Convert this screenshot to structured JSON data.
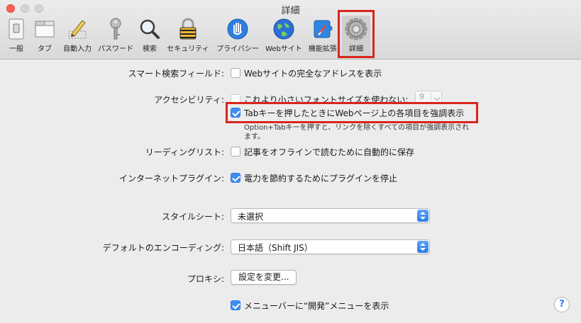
{
  "window": {
    "title": "詳細"
  },
  "toolbar": {
    "tabs": [
      {
        "label": "一般",
        "icon": "general-switch-icon"
      },
      {
        "label": "タブ",
        "icon": "tabs-icon"
      },
      {
        "label": "自動入力",
        "icon": "pencil-form-icon"
      },
      {
        "label": "パスワード",
        "icon": "key-icon"
      },
      {
        "label": "検索",
        "icon": "magnifier-icon"
      },
      {
        "label": "セキュリティ",
        "icon": "padlock-icon"
      },
      {
        "label": "プライバシー",
        "icon": "hand-icon"
      },
      {
        "label": "Webサイト",
        "icon": "globe-icon"
      },
      {
        "label": "機能拡張",
        "icon": "puzzle-compass-icon"
      },
      {
        "label": "詳細",
        "icon": "gear-icon",
        "selected": true
      }
    ]
  },
  "settings": {
    "smart_search": {
      "label": "スマート検索フィールド:",
      "option": "Webサイトの完全なアドレスを表示",
      "checked": false
    },
    "accessibility": {
      "label": "アクセシビリティ:",
      "option1": "これより小さいフォントサイズを使わない:",
      "font_size": "9",
      "option2": "Tabキーを押したときにWebページ上の各項目を強調表示",
      "option2_checked": true,
      "note": "Option+Tabキーを押すと、リンクを除くすべての項目が強調表示されます。"
    },
    "reading_list": {
      "label": "リーディングリスト:",
      "option": "記事をオフラインで読むために自動的に保存",
      "checked": false
    },
    "plugins": {
      "label": "インターネットプラグイン:",
      "option": "電力を節約するためにプラグインを停止",
      "checked": true
    },
    "stylesheet": {
      "label": "スタイルシート:",
      "value": "未選択"
    },
    "encoding": {
      "label": "デフォルトのエンコーディング:",
      "value": "日本語（Shift JIS）"
    },
    "proxy": {
      "label": "プロキシ:",
      "button": "設定を変更..."
    },
    "develop_menu": {
      "option": "メニューバーに“開発”メニューを表示",
      "checked": true
    }
  },
  "help": "?",
  "colors": {
    "highlight": "#d9251d",
    "accent": "#3d8ef2"
  }
}
